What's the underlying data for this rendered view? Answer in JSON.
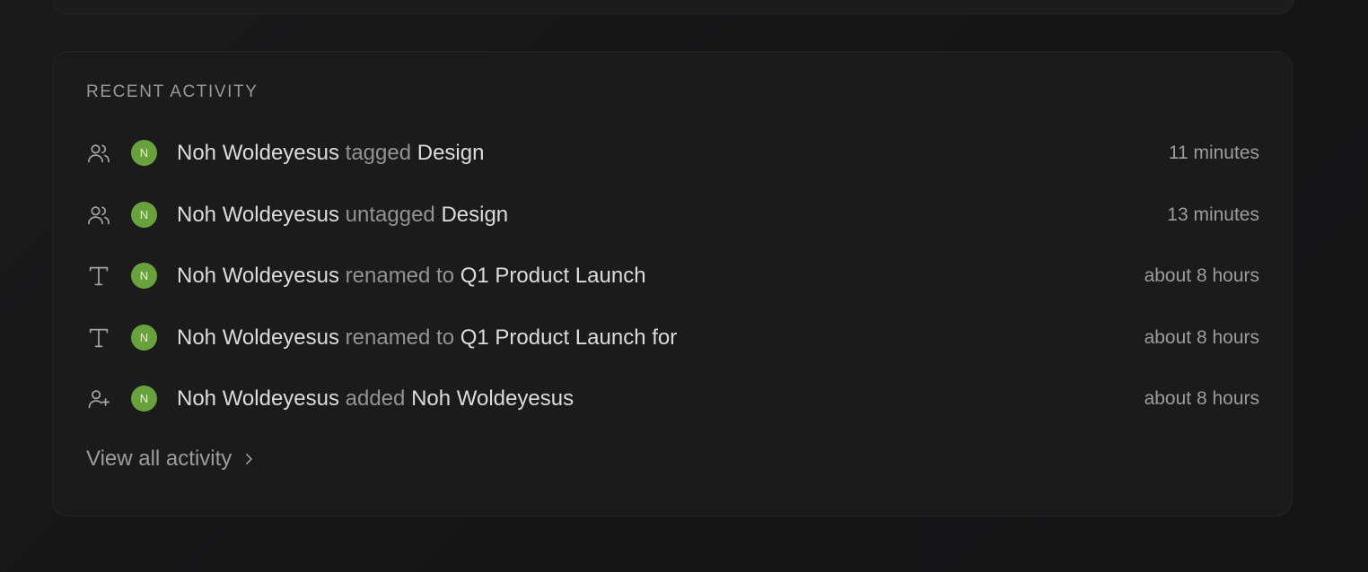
{
  "section": {
    "title": "RECENT ACTIVITY"
  },
  "activities": [
    {
      "icon": "users-icon",
      "avatar_initial": "N",
      "actor": "Noh Woldeyesus",
      "verb": "tagged",
      "target": "Design",
      "time": "11 minutes"
    },
    {
      "icon": "users-icon",
      "avatar_initial": "N",
      "actor": "Noh Woldeyesus",
      "verb": "untagged",
      "target": "Design",
      "time": "13 minutes"
    },
    {
      "icon": "text-icon",
      "avatar_initial": "N",
      "actor": "Noh Woldeyesus",
      "verb": "renamed to",
      "target": "Q1 Product Launch",
      "time": "about 8 hours"
    },
    {
      "icon": "text-icon",
      "avatar_initial": "N",
      "actor": "Noh Woldeyesus",
      "verb": "renamed to",
      "target": "Q1 Product Launch for",
      "time": "about 8 hours"
    },
    {
      "icon": "user-plus-icon",
      "avatar_initial": "N",
      "actor": "Noh Woldeyesus",
      "verb": "added",
      "target": "Noh Woldeyesus",
      "time": "about 8 hours"
    }
  ],
  "footer": {
    "view_all_label": "View all activity",
    "chevron_icon": "chevron-right-icon"
  },
  "colors": {
    "background": "#161617",
    "card": "#1b1b1c",
    "avatar": "#6aa13f",
    "primary_text": "#dcdcde",
    "muted_text": "#939396"
  }
}
